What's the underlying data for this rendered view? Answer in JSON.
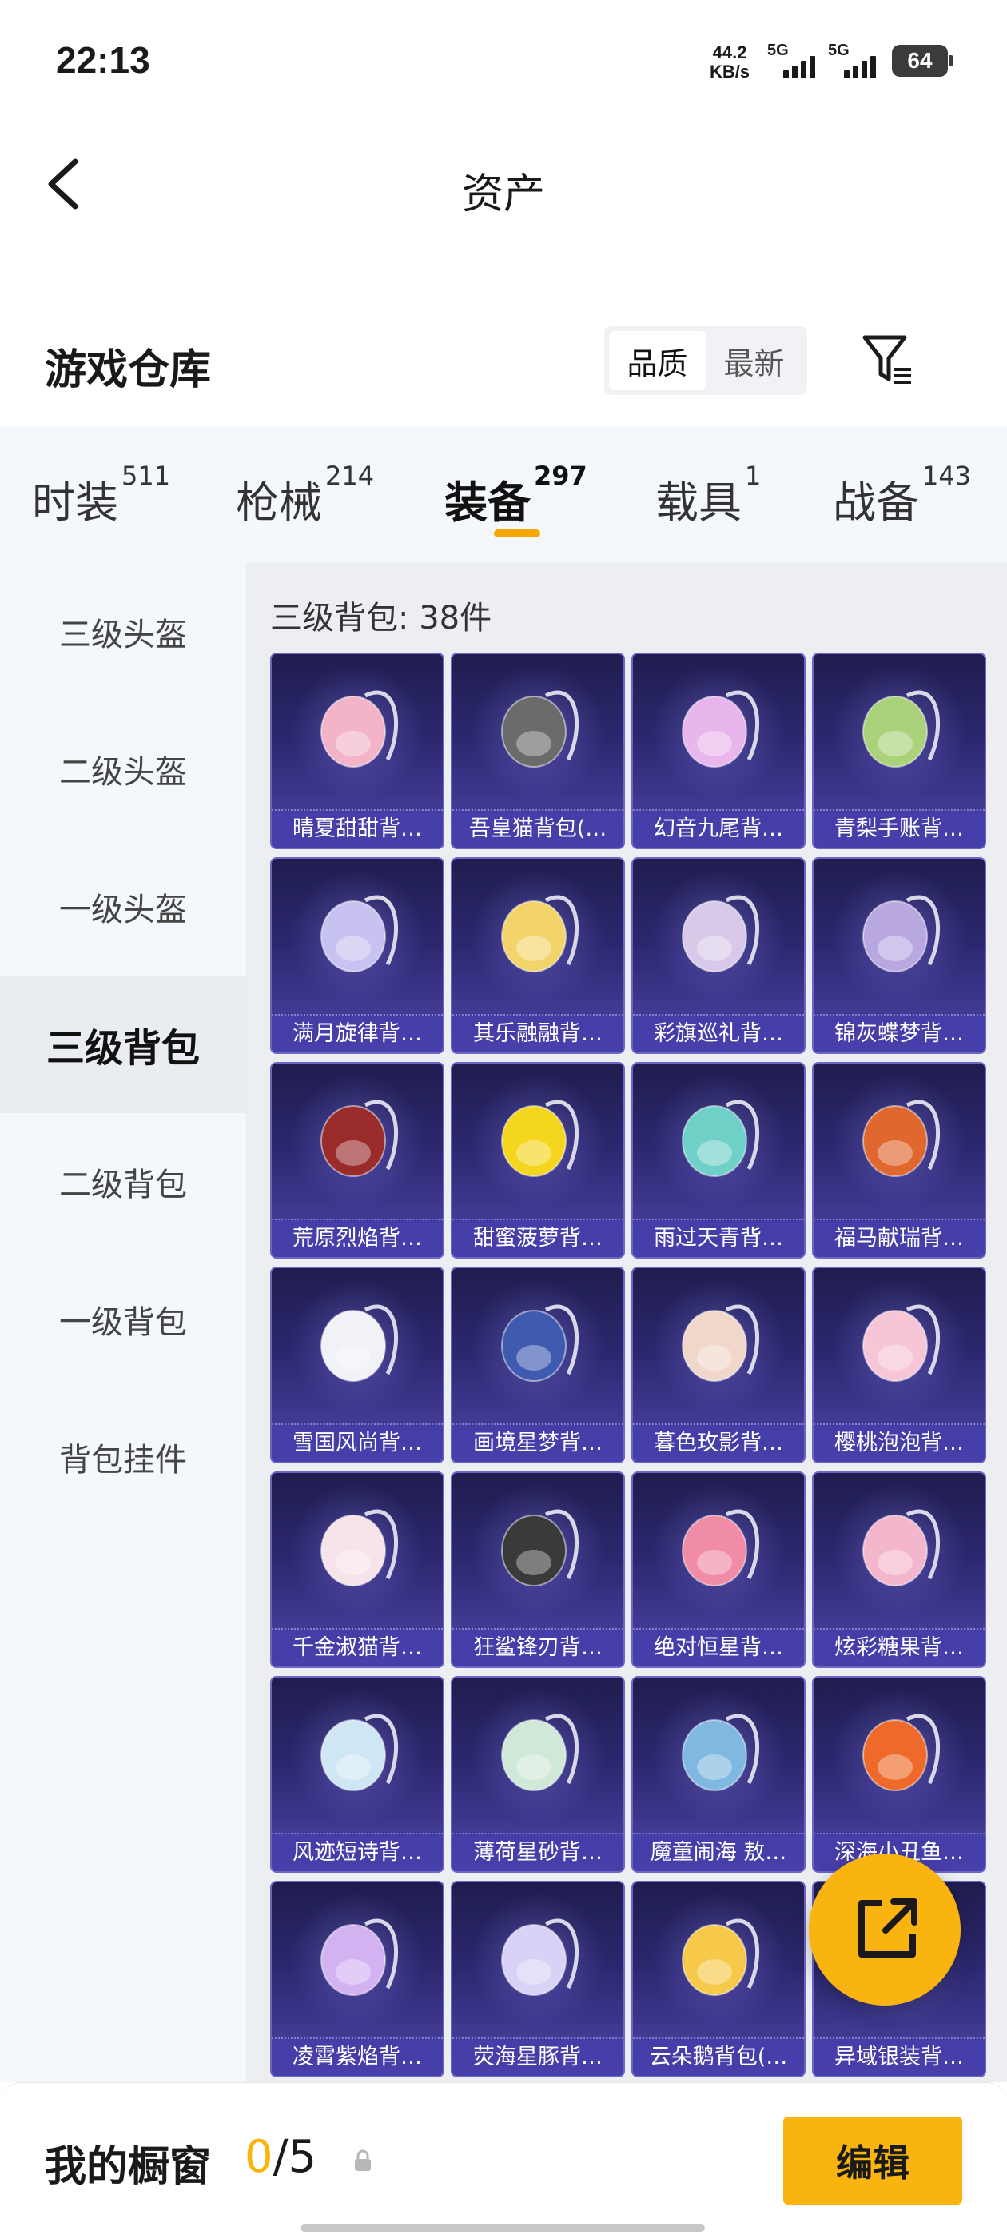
{
  "status_bar": {
    "time": "22:13",
    "net_speed_value": "44.2",
    "net_speed_unit": "KB/s",
    "sim1": "5G",
    "sim2": "5G",
    "battery": "64"
  },
  "nav": {
    "title": "资产"
  },
  "warehouse": {
    "title": "游戏仓库",
    "sort_options": [
      "品质",
      "最新"
    ],
    "active_sort": "品质"
  },
  "tabs": [
    {
      "label": "时装",
      "count": "511"
    },
    {
      "label": "枪械",
      "count": "214"
    },
    {
      "label": "装备",
      "count": "297",
      "active": true
    },
    {
      "label": "载具",
      "count": "1"
    },
    {
      "label": "战备",
      "count": "143"
    }
  ],
  "side_menu": [
    "三级头盔",
    "二级头盔",
    "一级头盔",
    "三级背包",
    "二级背包",
    "一级背包",
    "背包挂件"
  ],
  "active_side_item": "三级背包",
  "content": {
    "count_label": "三级背包: 38件"
  },
  "items": [
    {
      "name": "晴夏甜甜背…",
      "color": "#f3b4c8"
    },
    {
      "name": "吾皇猫背包(…",
      "color": "#6b6b6b"
    },
    {
      "name": "幻音九尾背…",
      "color": "#e8b5ec"
    },
    {
      "name": "青梨手账背…",
      "color": "#a9d27a"
    },
    {
      "name": "满月旋律背…",
      "color": "#c7c2f0"
    },
    {
      "name": "其乐融融背…",
      "color": "#f3d46a"
    },
    {
      "name": "彩旗巡礼背…",
      "color": "#d9c9e8"
    },
    {
      "name": "锦灰蝶梦背…",
      "color": "#b9a8e0"
    },
    {
      "name": "荒原烈焰背…",
      "color": "#9a2b2b"
    },
    {
      "name": "甜蜜菠萝背…",
      "color": "#f5d61e"
    },
    {
      "name": "雨过天青背…",
      "color": "#6fd0c8"
    },
    {
      "name": "福马献瑞背…",
      "color": "#e0672e"
    },
    {
      "name": "雪国风尚背…",
      "color": "#f1f1f8"
    },
    {
      "name": "画境星梦背…",
      "color": "#3f5bb0"
    },
    {
      "name": "暮色玫影背…",
      "color": "#f1d7c9"
    },
    {
      "name": "樱桃泡泡背…",
      "color": "#f6c6d6"
    },
    {
      "name": "千金淑猫背…",
      "color": "#f6e4ea"
    },
    {
      "name": "狂鲨锋刃背…",
      "color": "#3a3a3a"
    },
    {
      "name": "绝对恒星背…",
      "color": "#f08ca6"
    },
    {
      "name": "炫彩糖果背…",
      "color": "#f4b6cc"
    },
    {
      "name": "风迹短诗背…",
      "color": "#cfe6f4"
    },
    {
      "name": "薄荷星砂背…",
      "color": "#cfe8d8"
    },
    {
      "name": "魔童闹海 敖…",
      "color": "#7fb8e0"
    },
    {
      "name": "深海小丑鱼…",
      "color": "#ef6a2a"
    },
    {
      "name": "凌霄紫焰背…",
      "color": "#d2b2f0"
    },
    {
      "name": "荧海星豚背…",
      "color": "#d9d2f6"
    },
    {
      "name": "云朵鹅背包(…",
      "color": "#f6c94a"
    },
    {
      "name": "异域银装背…",
      "color": "#9aa7b0"
    }
  ],
  "bottom": {
    "showcase_label": "我的橱窗",
    "showcase_current": "0",
    "showcase_total": "/5",
    "edit_label": "编辑"
  },
  "colors": {
    "accent": "#f9b410",
    "card_top": "#1f1d4f",
    "card_bottom": "#4d46a8"
  },
  "icons": {
    "back": "chevron-left-icon",
    "filter": "filter-icon",
    "lock": "lock-icon",
    "share": "share-external-icon"
  }
}
